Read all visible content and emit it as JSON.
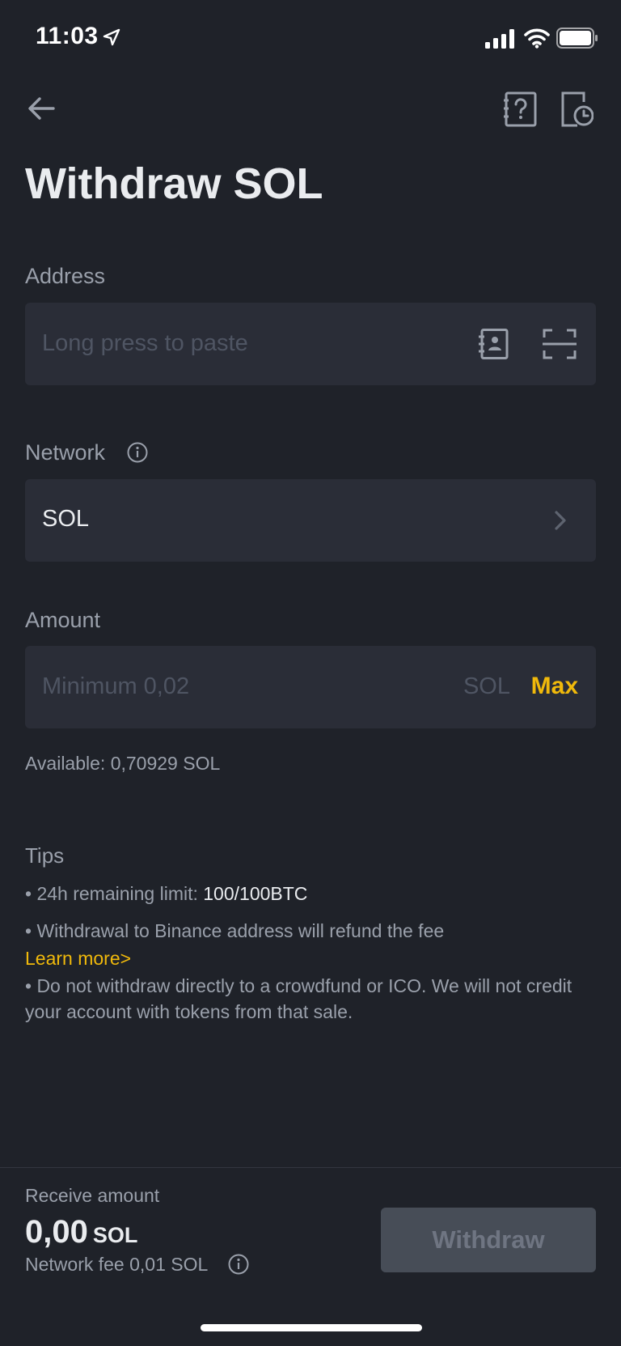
{
  "status_bar": {
    "time": "11:03"
  },
  "header": {
    "title": "Withdraw SOL"
  },
  "address": {
    "label": "Address",
    "placeholder": "Long press to paste"
  },
  "network": {
    "label": "Network",
    "value": "SOL"
  },
  "amount": {
    "label": "Amount",
    "placeholder": "Minimum 0,02",
    "unit": "SOL",
    "max_label": "Max",
    "available": "Available: 0,70929 SOL"
  },
  "tips": {
    "title": "Tips",
    "limit_prefix": "• 24h remaining limit: ",
    "limit_value": "100/100BTC",
    "refund": "• Withdrawal to Binance address will refund the fee",
    "learn_more": "Learn more>",
    "warning": "• Do not withdraw directly to a crowdfund or ICO. We will not credit your account with tokens from that sale."
  },
  "footer": {
    "receive_label": "Receive amount",
    "receive_value": "0,00",
    "receive_unit": "SOL",
    "fee": "Network fee 0,01 SOL",
    "withdraw_label": "Withdraw"
  },
  "colors": {
    "background": "#1f2229",
    "field": "#2a2d37",
    "accent": "#f0b90b",
    "button_disabled": "#474d57"
  },
  "icons": [
    "location-arrow-icon",
    "signal-icon",
    "wifi-icon",
    "battery-icon",
    "back-arrow-icon",
    "help-icon",
    "history-icon",
    "address-book-icon",
    "scan-icon",
    "info-icon",
    "chevron-right-icon"
  ]
}
